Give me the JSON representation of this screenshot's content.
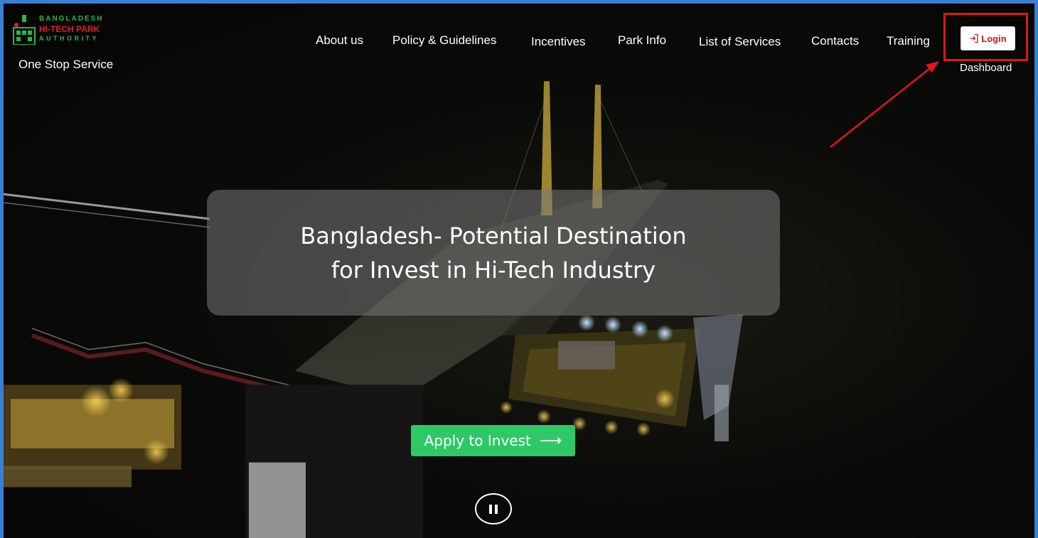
{
  "brand": {
    "line1": "BANGLADESH",
    "line2": "HI-TECH PARK",
    "line3": "AUTHORITY",
    "subtitle": "One Stop Service"
  },
  "nav": {
    "items": [
      {
        "label": "About us"
      },
      {
        "label": "Policy & Guidelines"
      },
      {
        "label": "Incentives"
      },
      {
        "label": "Park Info"
      },
      {
        "label": "List of Services"
      },
      {
        "label": "Contacts"
      },
      {
        "label": "Training"
      }
    ],
    "login_label": "Login",
    "dashboard_label": "Dashboard"
  },
  "hero": {
    "headline_line1": "Bangladesh- Potential Destination",
    "headline_line2": "for Invest in Hi-Tech Industry",
    "cta_label": "Apply to Invest",
    "cta_arrow": "⟶"
  },
  "icons": {
    "login": "login-icon",
    "pause": "pause-icon",
    "cta_arrow": "arrow-right-icon"
  },
  "colors": {
    "frame_border": "#3b7fd1",
    "highlight": "#e0161c",
    "login_text": "#d0141b",
    "cta_bg": "#2ec866",
    "logo_green": "#2fb34a",
    "logo_red": "#d4232f"
  }
}
